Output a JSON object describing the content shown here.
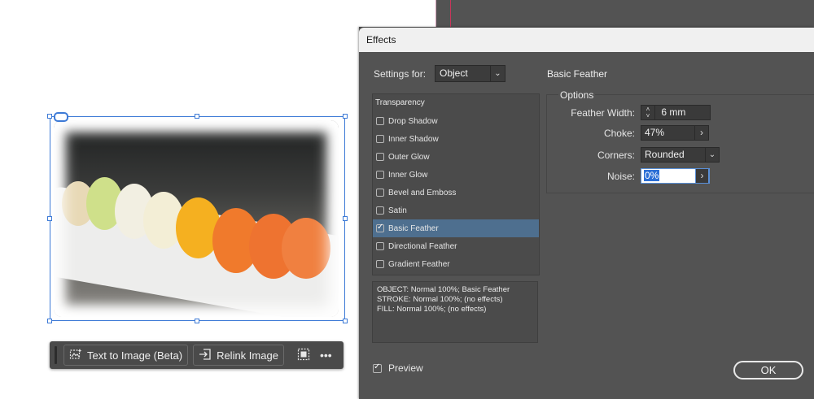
{
  "taskbar": {
    "text_to_image_label": "Text to Image (Beta)",
    "relink_label": "Relink Image",
    "more_label": "•••"
  },
  "dialog": {
    "title": "Effects",
    "settings_for_label": "Settings for:",
    "settings_for_value": "Object",
    "effects_list": {
      "header": "Transparency",
      "items": [
        {
          "label": "Drop Shadow",
          "checked": false
        },
        {
          "label": "Inner Shadow",
          "checked": false
        },
        {
          "label": "Outer Glow",
          "checked": false
        },
        {
          "label": "Inner Glow",
          "checked": false
        },
        {
          "label": "Bevel and Emboss",
          "checked": false
        },
        {
          "label": "Satin",
          "checked": false
        },
        {
          "label": "Basic Feather",
          "checked": true
        },
        {
          "label": "Directional Feather",
          "checked": false
        },
        {
          "label": "Gradient Feather",
          "checked": false
        }
      ],
      "selected": "Basic Feather"
    },
    "summary": {
      "line1": "OBJECT: Normal 100%; Basic Feather",
      "line2": "STROKE: Normal 100%; (no effects)",
      "line3": "FILL: Normal 100%; (no effects)"
    },
    "section_title": "Basic Feather",
    "options": {
      "group_title": "Options",
      "feather_width_label": "Feather Width:",
      "feather_width_value": "6 mm",
      "choke_label": "Choke:",
      "choke_value": "47%",
      "corners_label": "Corners:",
      "corners_value": "Rounded",
      "noise_label": "Noise:",
      "noise_value": "0%"
    },
    "preview_label": "Preview",
    "preview_checked": true,
    "ok_label": "OK"
  },
  "colors": {
    "selection_accent": "#3d7ad6",
    "dialog_bg": "#535353",
    "list_selected": "#4e6f8f"
  }
}
